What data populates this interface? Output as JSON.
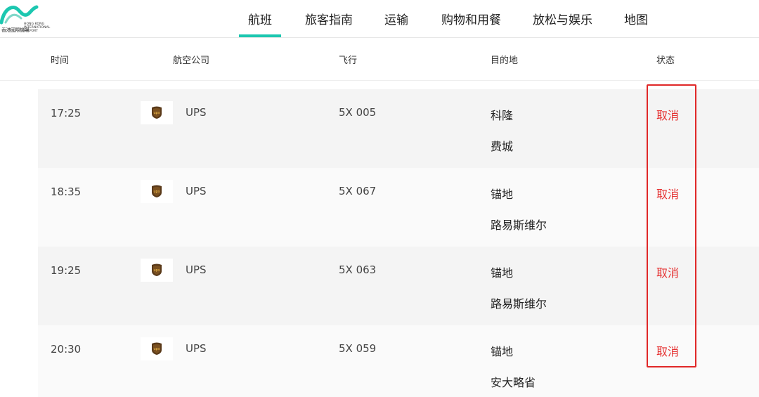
{
  "logo": {
    "cn": "香港國際機場",
    "en": [
      "HONG KONG",
      "INTERNATIONAL",
      "AIRPORT"
    ],
    "colors": [
      "#1cc7b0",
      "#7fd7c8"
    ]
  },
  "nav": {
    "items": [
      {
        "label": "航班",
        "active": true
      },
      {
        "label": "旅客指南"
      },
      {
        "label": "运输"
      },
      {
        "label": "购物和用餐"
      },
      {
        "label": "放松与娱乐"
      },
      {
        "label": "地图"
      }
    ],
    "accent": "#1cc7b0"
  },
  "table": {
    "headers": {
      "time": "时间",
      "airline": "航空公司",
      "flight": "飞行",
      "destination": "目的地",
      "status": "状态"
    },
    "rows": [
      {
        "time": "17:25",
        "airline": "UPS",
        "airline_icon": "ups-logo-icon",
        "flight": "5X 005",
        "destination": [
          "科隆",
          "费城"
        ],
        "status": "取消"
      },
      {
        "time": "18:35",
        "airline": "UPS",
        "airline_icon": "ups-logo-icon",
        "flight": "5X 067",
        "destination": [
          "锚地",
          "路易斯维尔"
        ],
        "status": "取消"
      },
      {
        "time": "19:25",
        "airline": "UPS",
        "airline_icon": "ups-logo-icon",
        "flight": "5X 063",
        "destination": [
          "锚地",
          "路易斯维尔"
        ],
        "status": "取消"
      },
      {
        "time": "20:30",
        "airline": "UPS",
        "airline_icon": "ups-logo-icon",
        "flight": "5X 059",
        "destination": [
          "锚地",
          "安大略省"
        ],
        "status": "取消"
      }
    ],
    "status_color": "#e53030",
    "highlight_color": "#e02828"
  }
}
